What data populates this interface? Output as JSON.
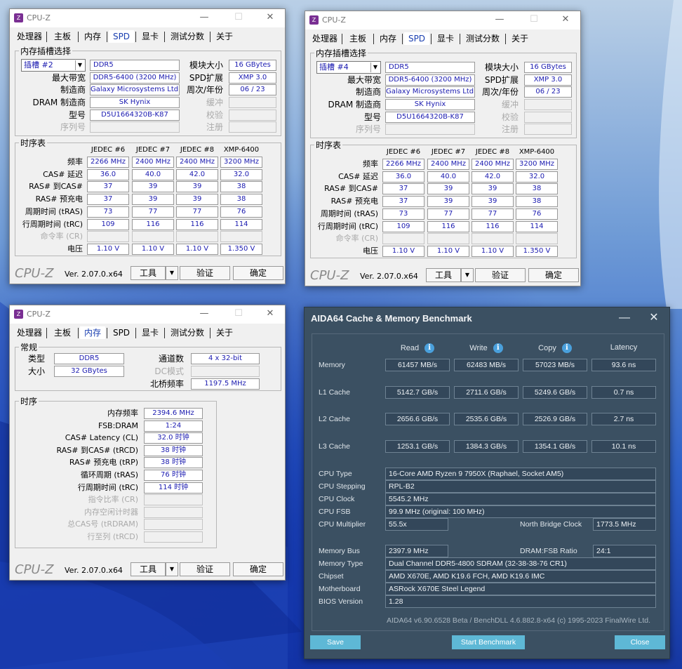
{
  "cpuz_common": {
    "title": "CPU-Z",
    "tabs": [
      "处理器",
      "主板",
      "内存",
      "SPD",
      "显卡",
      "测试分数",
      "关于"
    ],
    "footer": {
      "logo": "CPU-Z",
      "version": "Ver. 2.07.0.x64",
      "tools": "工具",
      "validate": "验证",
      "ok": "确定"
    }
  },
  "spd": {
    "group_slot": "内存插槽选择",
    "labels": {
      "max_bandwidth": "最大带宽",
      "manufacturer": "制造商",
      "dram_mfr": "DRAM 制造商",
      "part": "型号",
      "serial": "序列号",
      "module_size": "模块大小",
      "spd_ext": "SPD扩展",
      "week_year": "周次/年份",
      "buffered": "缓冲",
      "checksum": "校验",
      "registered": "注册"
    },
    "timing_group": "时序表",
    "timing_labels": [
      "频率",
      "CAS# 延迟",
      "RAS# 到CAS#",
      "RAS# 预充电",
      "周期时间 (tRAS)",
      "行周期时间 (tRC)",
      "命令率 (CR)",
      "电压"
    ],
    "timing_cols": [
      "JEDEC #6",
      "JEDEC #7",
      "JEDEC #8",
      "XMP-6400"
    ],
    "timing_rows": [
      [
        "2266 MHz",
        "2400 MHz",
        "2400 MHz",
        "3200 MHz"
      ],
      [
        "36.0",
        "40.0",
        "42.0",
        "32.0"
      ],
      [
        "37",
        "39",
        "39",
        "38"
      ],
      [
        "37",
        "39",
        "39",
        "38"
      ],
      [
        "73",
        "77",
        "77",
        "76"
      ],
      [
        "109",
        "116",
        "116",
        "114"
      ],
      [
        "",
        "",
        "",
        ""
      ],
      [
        "1.10 V",
        "1.10 V",
        "1.10 V",
        "1.350 V"
      ]
    ],
    "slot_a": {
      "slot": "插槽 #2",
      "type": "DDR5",
      "max_bw": "DDR5-6400 (3200 MHz)",
      "mfr": "Galaxy Microsystems Ltd.",
      "dram": "SK Hynix",
      "part": "D5U1664320B-K87",
      "serial": "",
      "size": "16 GBytes",
      "ext": "XMP 3.0",
      "week": "06 / 23"
    },
    "slot_b": {
      "slot": "插槽 #4",
      "type": "DDR5",
      "max_bw": "DDR5-6400 (3200 MHz)",
      "mfr": "Galaxy Microsystems Ltd.",
      "dram": "SK Hynix",
      "part": "D5U1664320B-K87",
      "serial": "",
      "size": "16 GBytes",
      "ext": "XMP 3.0",
      "week": "06 / 23"
    }
  },
  "mem": {
    "general": "常规",
    "labels": {
      "type": "类型",
      "size": "大小",
      "channels": "通道数",
      "dc_mode": "DC模式",
      "nb_freq": "北桥频率"
    },
    "values": {
      "type": "DDR5",
      "size": "32 GBytes",
      "channels": "4 x 32-bit",
      "dc_mode": "",
      "nb_freq": "1197.5 MHz"
    },
    "timing_group": "时序",
    "timings": [
      {
        "label": "内存频率",
        "value": "2394.6 MHz",
        "dis": false
      },
      {
        "label": "FSB:DRAM",
        "value": "1:24",
        "dis": false
      },
      {
        "label": "CAS# Latency (CL)",
        "value": "32.0 时钟",
        "dis": false
      },
      {
        "label": "RAS# 到CAS# (tRCD)",
        "value": "38 时钟",
        "dis": false
      },
      {
        "label": "RAS# 预充电 (tRP)",
        "value": "38 时钟",
        "dis": false
      },
      {
        "label": "循环周期 (tRAS)",
        "value": "76 时钟",
        "dis": false
      },
      {
        "label": "行周期时间 (tRC)",
        "value": "114 时钟",
        "dis": false
      },
      {
        "label": "指令比率 (CR)",
        "value": "",
        "dis": true
      },
      {
        "label": "内存空闲计时器",
        "value": "",
        "dis": true
      },
      {
        "label": "总CAS号 (tRDRAM)",
        "value": "",
        "dis": true
      },
      {
        "label": "行至列 (tRCD)",
        "value": "",
        "dis": true
      }
    ]
  },
  "aida": {
    "title": "AIDA64 Cache & Memory Benchmark",
    "cols": [
      "Read",
      "Write",
      "Copy",
      "Latency"
    ],
    "rows": [
      {
        "label": "Memory",
        "vals": [
          "61457 MB/s",
          "62483 MB/s",
          "57023 MB/s",
          "93.6 ns"
        ]
      },
      {
        "label": "L1 Cache",
        "vals": [
          "5142.7 GB/s",
          "2711.6 GB/s",
          "5249.6 GB/s",
          "0.7 ns"
        ]
      },
      {
        "label": "L2 Cache",
        "vals": [
          "2656.6 GB/s",
          "2535.6 GB/s",
          "2526.9 GB/s",
          "2.7 ns"
        ]
      },
      {
        "label": "L3 Cache",
        "vals": [
          "1253.1 GB/s",
          "1384.3 GB/s",
          "1354.1 GB/s",
          "10.1 ns"
        ]
      }
    ],
    "cpu": {
      "type_label": "CPU Type",
      "type": "16-Core AMD Ryzen 9 7950X  (Raphael, Socket AM5)",
      "stepping_label": "CPU Stepping",
      "stepping": "RPL-B2",
      "clock_label": "CPU Clock",
      "clock": "5545.2 MHz",
      "fsb_label": "CPU FSB",
      "fsb": "99.9 MHz  (original: 100 MHz)",
      "mult_label": "CPU Multiplier",
      "mult": "55.5x",
      "nb_label": "North Bridge Clock",
      "nb": "1773.5 MHz"
    },
    "mem": {
      "bus_label": "Memory Bus",
      "bus": "2397.9 MHz",
      "ratio_label": "DRAM:FSB Ratio",
      "ratio": "24:1",
      "type_label": "Memory Type",
      "type": "Dual Channel DDR5-4800 SDRAM  (32-38-38-76 CR1)",
      "chipset_label": "Chipset",
      "chipset": "AMD X670E, AMD K19.6 FCH, AMD K19.6 IMC",
      "mb_label": "Motherboard",
      "mb": "ASRock X670E Steel Legend",
      "bios_label": "BIOS Version",
      "bios": "1.28"
    },
    "footer": "AIDA64 v6.90.6528 Beta / BenchDLL 4.6.882.8-x64  (c) 1995-2023 FinalWire Ltd.",
    "buttons": {
      "save": "Save",
      "start": "Start Benchmark",
      "close": "Close"
    }
  }
}
